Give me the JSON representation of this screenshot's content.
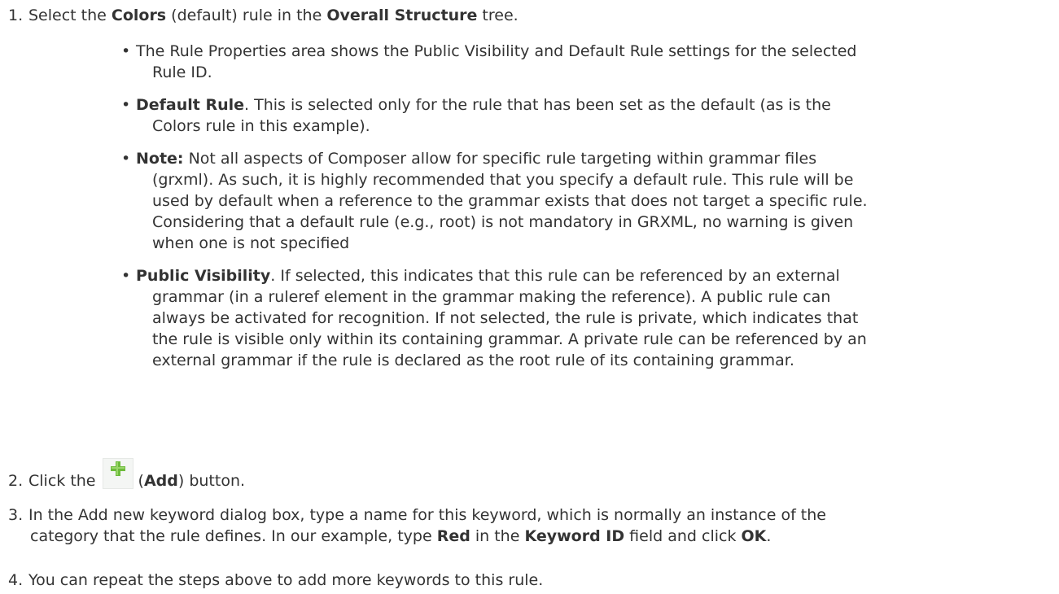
{
  "steps": [
    {
      "num": "1.",
      "pre": "Select the ",
      "bold1": "Colors",
      "mid": " (default) rule in the ",
      "bold2": "Overall Structure",
      "post": " tree."
    },
    {
      "num": "2.",
      "pre": "Click the ",
      "paren_open": "(",
      "bold1": "Add",
      "post": ") button."
    },
    {
      "num": "3.",
      "line1": "In the Add new keyword dialog box, type a name for this keyword, which is normally an instance of the",
      "line2_pre": "category that the rule defines. In our example, type ",
      "bold1": "Red",
      "line2_mid": " in the ",
      "bold2": "Keyword ID",
      "line2_mid2": " field and click ",
      "bold3": "OK",
      "line2_post": "."
    },
    {
      "num": "4.",
      "text": "You can repeat the steps above to add more keywords to this rule."
    }
  ],
  "bullets": [
    {
      "lines": [
        "The Rule Properties area shows the Public Visibility and Default Rule settings for the selected",
        "Rule ID."
      ]
    },
    {
      "bold": "Default Rule",
      "lines": [
        ". This is selected only for the rule that has been set as the default (as is the",
        "Colors rule in this example)."
      ]
    },
    {
      "bold": "Note:",
      "lines": [
        " Not all aspects of Composer allow for specific rule targeting within grammar files",
        "(grxml).  As such, it is highly recommended that you specify a default rule.  This rule will be",
        "used by default when a reference to the grammar exists that does not target a specific rule.",
        " Considering that a default rule (e.g., root) is not mandatory in GRXML, no warning is given",
        "when one is not specified"
      ]
    },
    {
      "bold": "Public Visibility",
      "lines": [
        ".  If selected, this indicates that this rule can be referenced by an external",
        "grammar (in a ruleref element in the grammar making the reference). A public rule can",
        "always be activated for recognition. If not selected, the rule is private, which indicates that",
        "the rule is visible only within its containing grammar. A private rule can be referenced by an",
        "external grammar if the rule is declared as the root rule of its containing grammar."
      ]
    }
  ],
  "icons": {
    "add": "plus-icon",
    "add_color": "#6dbb3c",
    "add_bg": "#f4f6f4"
  }
}
